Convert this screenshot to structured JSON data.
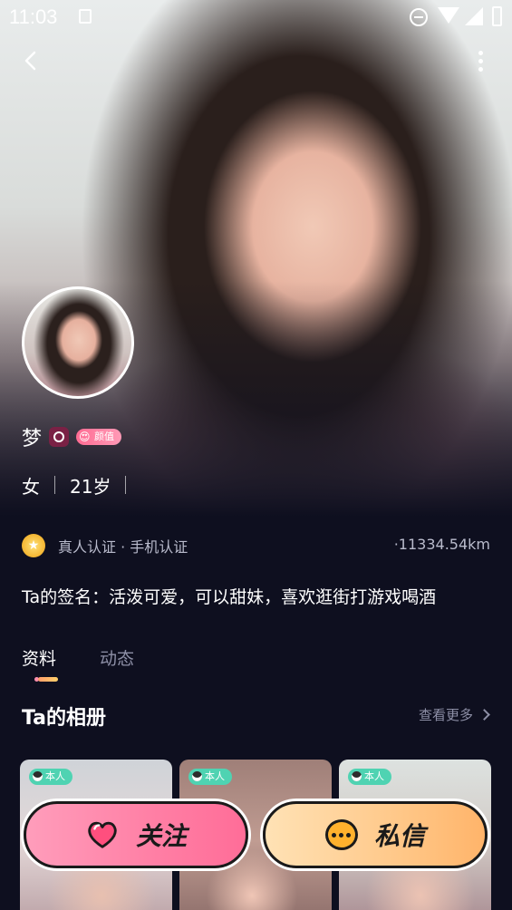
{
  "status_bar": {
    "time": "11:03"
  },
  "profile": {
    "name": "梦",
    "badge_label": "颜值",
    "gender": "女",
    "age": "21岁",
    "verification": "真人认证 · 手机认证",
    "distance": "·11334.54km",
    "signature": "Ta的签名：活泼可爱，可以甜妹，喜欢逛街打游戏喝酒"
  },
  "tabs": [
    {
      "label": "资料"
    },
    {
      "label": "动态"
    }
  ],
  "album": {
    "title": "Ta的相册",
    "more_label": "查看更多",
    "photos": [
      {
        "tag": "本人"
      },
      {
        "tag": "本人"
      },
      {
        "tag": "本人"
      }
    ]
  },
  "actions": {
    "follow_label": "关注",
    "message_label": "私信"
  },
  "colors": {
    "background": "#0e0f1f",
    "follow_button": "#ff7ea4",
    "message_button": "#ffc889",
    "self_tag": "#4fd3b2"
  }
}
